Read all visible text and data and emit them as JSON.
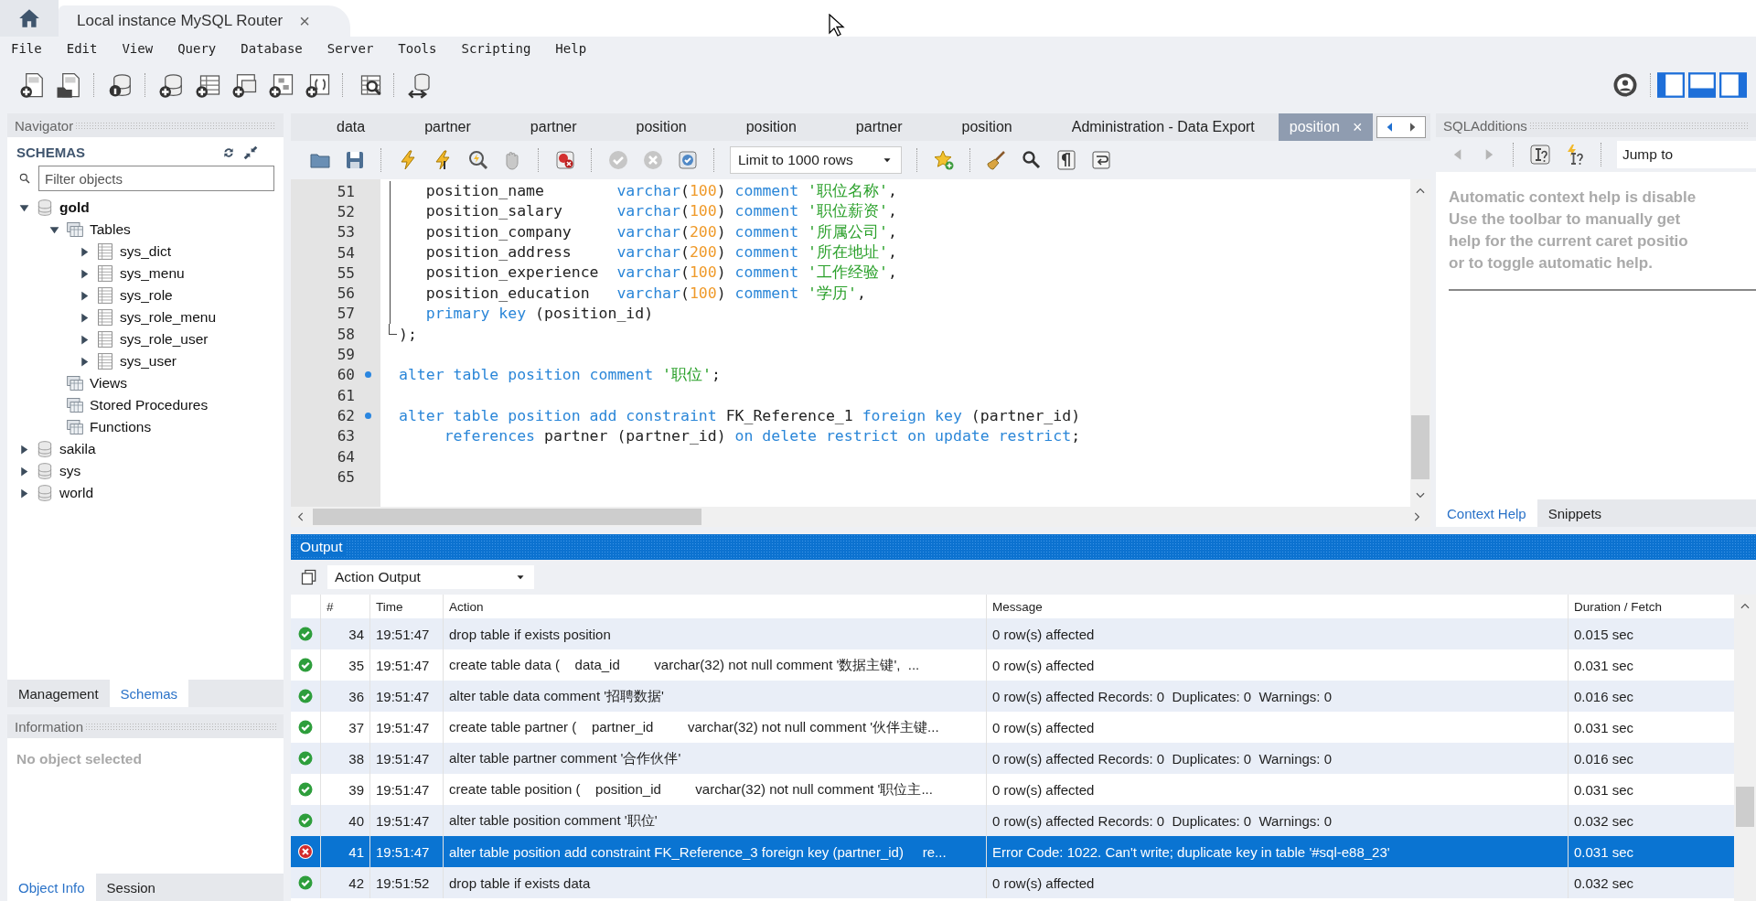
{
  "window_tabs": [
    {
      "label": "Local instance MySQL Router",
      "close": "×",
      "selected": true
    }
  ],
  "menu": [
    "File",
    "Edit",
    "View",
    "Query",
    "Database",
    "Server",
    "Tools",
    "Scripting",
    "Help"
  ],
  "layout_toggles": [
    {
      "kind": "left",
      "on": true
    },
    {
      "kind": "bottom",
      "on": true
    },
    {
      "kind": "right",
      "on": true
    }
  ],
  "navigator": {
    "title": "Navigator",
    "section": "SCHEMAS",
    "filter": {
      "placeholder": "Filter objects"
    },
    "tree": [
      {
        "label": "gold",
        "kind": "schema",
        "expandable": true,
        "expanded": true,
        "default": true,
        "children": [
          {
            "label": "Tables",
            "kind": "folder",
            "expandable": true,
            "expanded": true,
            "children": [
              {
                "label": "sys_dict",
                "kind": "table",
                "expandable": true,
                "expanded": false
              },
              {
                "label": "sys_menu",
                "kind": "table",
                "expandable": true,
                "expanded": false
              },
              {
                "label": "sys_role",
                "kind": "table",
                "expandable": true,
                "expanded": false
              },
              {
                "label": "sys_role_menu",
                "kind": "table",
                "expandable": true,
                "expanded": false
              },
              {
                "label": "sys_role_user",
                "kind": "table",
                "expandable": true,
                "expanded": false
              },
              {
                "label": "sys_user",
                "kind": "table",
                "expandable": true,
                "expanded": false
              }
            ]
          },
          {
            "label": "Views",
            "kind": "folder",
            "expandable": false
          },
          {
            "label": "Stored Procedures",
            "kind": "folder",
            "expandable": false
          },
          {
            "label": "Functions",
            "kind": "folder",
            "expandable": false
          }
        ]
      },
      {
        "label": "sakila",
        "kind": "schema",
        "expandable": true,
        "expanded": false,
        "default": false
      },
      {
        "label": "sys",
        "kind": "schema",
        "expandable": true,
        "expanded": false,
        "default": false
      },
      {
        "label": "world",
        "kind": "schema",
        "expandable": true,
        "expanded": false,
        "default": false
      }
    ],
    "tabs": [
      {
        "label": "Management",
        "selected": false
      },
      {
        "label": "Schemas",
        "selected": true
      }
    ]
  },
  "information": {
    "title": "Information",
    "text": "No object selected",
    "tabs": [
      {
        "label": "Object Info",
        "selected": true
      },
      {
        "label": "Session",
        "selected": false
      }
    ]
  },
  "editor": {
    "tabs": [
      {
        "label": "data",
        "selected": false
      },
      {
        "label": "partner",
        "selected": false
      },
      {
        "label": "partner",
        "selected": false
      },
      {
        "label": "position",
        "selected": false
      },
      {
        "label": "position",
        "selected": false
      },
      {
        "label": "partner",
        "selected": false
      },
      {
        "label": "position",
        "selected": false
      },
      {
        "label": "Administration - Data Export",
        "selected": false
      },
      {
        "label": "position",
        "selected": true,
        "close": "×"
      }
    ],
    "limit": "Limit to 1000 rows",
    "lines": [
      {
        "number": "51",
        "marker": false,
        "fold_line": true,
        "fold_end": false,
        "segments": [
          {
            "kind": "plain",
            "text": "   position_name        "
          },
          {
            "kind": "keyword",
            "text": "varchar"
          },
          {
            "kind": "plain",
            "text": "("
          },
          {
            "kind": "number",
            "text": "100"
          },
          {
            "kind": "plain",
            "text": ") "
          },
          {
            "kind": "keyword",
            "text": "comment "
          },
          {
            "kind": "string",
            "text": "'职位名称'"
          },
          {
            "kind": "plain",
            "text": ","
          }
        ]
      },
      {
        "number": "52",
        "marker": false,
        "fold_line": true,
        "fold_end": false,
        "segments": [
          {
            "kind": "plain",
            "text": "   position_salary      "
          },
          {
            "kind": "keyword",
            "text": "varchar"
          },
          {
            "kind": "plain",
            "text": "("
          },
          {
            "kind": "number",
            "text": "100"
          },
          {
            "kind": "plain",
            "text": ") "
          },
          {
            "kind": "keyword",
            "text": "comment "
          },
          {
            "kind": "string",
            "text": "'职位薪资'"
          },
          {
            "kind": "plain",
            "text": ","
          }
        ]
      },
      {
        "number": "53",
        "marker": false,
        "fold_line": true,
        "fold_end": false,
        "segments": [
          {
            "kind": "plain",
            "text": "   position_company     "
          },
          {
            "kind": "keyword",
            "text": "varchar"
          },
          {
            "kind": "plain",
            "text": "("
          },
          {
            "kind": "number",
            "text": "200"
          },
          {
            "kind": "plain",
            "text": ") "
          },
          {
            "kind": "keyword",
            "text": "comment "
          },
          {
            "kind": "string",
            "text": "'所属公司'"
          },
          {
            "kind": "plain",
            "text": ","
          }
        ]
      },
      {
        "number": "54",
        "marker": false,
        "fold_line": true,
        "fold_end": false,
        "segments": [
          {
            "kind": "plain",
            "text": "   position_address     "
          },
          {
            "kind": "keyword",
            "text": "varchar"
          },
          {
            "kind": "plain",
            "text": "("
          },
          {
            "kind": "number",
            "text": "200"
          },
          {
            "kind": "plain",
            "text": ") "
          },
          {
            "kind": "keyword",
            "text": "comment "
          },
          {
            "kind": "string",
            "text": "'所在地址'"
          },
          {
            "kind": "plain",
            "text": ","
          }
        ]
      },
      {
        "number": "55",
        "marker": false,
        "fold_line": true,
        "fold_end": false,
        "segments": [
          {
            "kind": "plain",
            "text": "   position_experience  "
          },
          {
            "kind": "keyword",
            "text": "varchar"
          },
          {
            "kind": "plain",
            "text": "("
          },
          {
            "kind": "number",
            "text": "100"
          },
          {
            "kind": "plain",
            "text": ") "
          },
          {
            "kind": "keyword",
            "text": "comment "
          },
          {
            "kind": "string",
            "text": "'工作经验'"
          },
          {
            "kind": "plain",
            "text": ","
          }
        ]
      },
      {
        "number": "56",
        "marker": false,
        "fold_line": true,
        "fold_end": false,
        "segments": [
          {
            "kind": "plain",
            "text": "   position_education   "
          },
          {
            "kind": "keyword",
            "text": "varchar"
          },
          {
            "kind": "plain",
            "text": "("
          },
          {
            "kind": "number",
            "text": "100"
          },
          {
            "kind": "plain",
            "text": ") "
          },
          {
            "kind": "keyword",
            "text": "comment "
          },
          {
            "kind": "string",
            "text": "'学历'"
          },
          {
            "kind": "plain",
            "text": ","
          }
        ]
      },
      {
        "number": "57",
        "marker": false,
        "fold_line": true,
        "fold_end": false,
        "segments": [
          {
            "kind": "keyword",
            "text": "   primary key"
          },
          {
            "kind": "plain",
            "text": " (position_id)"
          }
        ]
      },
      {
        "number": "58",
        "marker": false,
        "fold_line": false,
        "fold_end": true,
        "segments": [
          {
            "kind": "plain",
            "text": ");"
          }
        ]
      },
      {
        "number": "59",
        "marker": false,
        "fold_line": false,
        "fold_end": false
      },
      {
        "number": "60",
        "marker": true,
        "fold_line": false,
        "fold_end": false,
        "segments": [
          {
            "kind": "keyword",
            "text": "alter table position comment "
          },
          {
            "kind": "string",
            "text": "'职位'"
          },
          {
            "kind": "plain",
            "text": ";"
          }
        ]
      },
      {
        "number": "61",
        "marker": false,
        "fold_line": false,
        "fold_end": false
      },
      {
        "number": "62",
        "marker": true,
        "fold_line": false,
        "fold_end": false,
        "segments": [
          {
            "kind": "keyword",
            "text": "alter table position add constraint "
          },
          {
            "kind": "plain",
            "text": "FK_Reference_1 "
          },
          {
            "kind": "keyword",
            "text": "foreign key"
          },
          {
            "kind": "plain",
            "text": " (partner_id)"
          }
        ]
      },
      {
        "number": "63",
        "marker": false,
        "fold_line": false,
        "fold_end": false,
        "segments": [
          {
            "kind": "keyword",
            "text": "     references"
          },
          {
            "kind": "plain",
            "text": " partner (partner_id) "
          },
          {
            "kind": "keyword",
            "text": "on delete restrict on update restrict"
          },
          {
            "kind": "plain",
            "text": ";"
          }
        ]
      },
      {
        "number": "64",
        "marker": false,
        "fold_line": false,
        "fold_end": false
      },
      {
        "number": "65",
        "marker": false,
        "fold_line": false,
        "fold_end": false
      }
    ]
  },
  "sql_additions": {
    "title": "SQLAdditions",
    "jump_to": "Jump to",
    "help_lines": [
      "Automatic context help is disable",
      "Use the toolbar to manually get",
      "help for the current caret positio",
      "or to toggle automatic help."
    ],
    "tabs": [
      {
        "label": "Context Help",
        "selected": true
      },
      {
        "label": "Snippets",
        "selected": false
      }
    ]
  },
  "output": {
    "title": "Output",
    "mode": "Action Output",
    "columns": [
      "#",
      "Time",
      "Action",
      "Message",
      "Duration / Fetch"
    ],
    "rows": [
      {
        "failed": false,
        "number": "34",
        "time": "19:51:47",
        "action": "drop table if exists position",
        "message": "0 row(s) affected",
        "duration": "0.015 sec",
        "selected": false
      },
      {
        "failed": false,
        "number": "35",
        "time": "19:51:47",
        "action": "create table data (    data_id         varchar(32) not null comment '数据主键',  ...",
        "message": "0 row(s) affected",
        "duration": "0.031 sec",
        "selected": false
      },
      {
        "failed": false,
        "number": "36",
        "time": "19:51:47",
        "action": "alter table data comment '招聘数据'",
        "message": "0 row(s) affected Records: 0  Duplicates: 0  Warnings: 0",
        "duration": "0.016 sec",
        "selected": false
      },
      {
        "failed": false,
        "number": "37",
        "time": "19:51:47",
        "action": "create table partner (    partner_id         varchar(32) not null comment '伙伴主键...",
        "message": "0 row(s) affected",
        "duration": "0.031 sec",
        "selected": false
      },
      {
        "failed": false,
        "number": "38",
        "time": "19:51:47",
        "action": "alter table partner comment '合作伙伴'",
        "message": "0 row(s) affected Records: 0  Duplicates: 0  Warnings: 0",
        "duration": "0.016 sec",
        "selected": false
      },
      {
        "failed": false,
        "number": "39",
        "time": "19:51:47",
        "action": "create table position (    position_id         varchar(32) not null comment '职位主...",
        "message": "0 row(s) affected",
        "duration": "0.031 sec",
        "selected": false
      },
      {
        "failed": false,
        "number": "40",
        "time": "19:51:47",
        "action": "alter table position comment '职位'",
        "message": "0 row(s) affected Records: 0  Duplicates: 0  Warnings: 0",
        "duration": "0.032 sec",
        "selected": false
      },
      {
        "failed": true,
        "number": "41",
        "time": "19:51:47",
        "action": "alter table position add constraint FK_Reference_3 foreign key (partner_id)     re...",
        "message": "Error Code: 1022. Can't write; duplicate key in table '#sql-e88_23'",
        "duration": "0.031 sec",
        "selected": true
      },
      {
        "failed": false,
        "number": "42",
        "time": "19:51:52",
        "action": "drop table if exists data",
        "message": "0 row(s) affected",
        "duration": "0.032 sec",
        "selected": false
      }
    ]
  }
}
